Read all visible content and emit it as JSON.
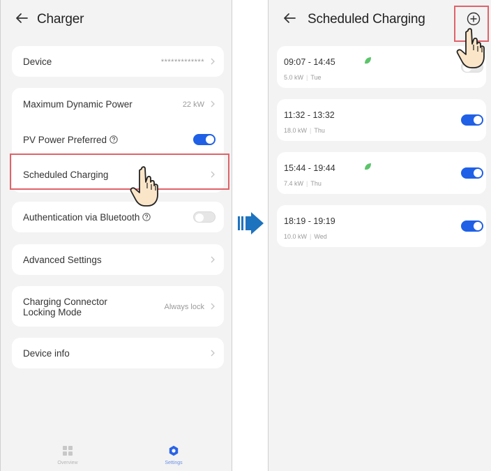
{
  "left": {
    "title": "Charger",
    "device": {
      "label": "Device",
      "value": "*************"
    },
    "max_power": {
      "label": "Maximum Dynamic Power",
      "value": "22 kW"
    },
    "pv_preferred": {
      "label": "PV Power Preferred",
      "state": "on"
    },
    "scheduled": {
      "label": "Scheduled Charging"
    },
    "bluetooth": {
      "label": "Authentication via Bluetooth",
      "state": "off"
    },
    "advanced": {
      "label": "Advanced Settings"
    },
    "locking": {
      "label_line1": "Charging Connector",
      "label_line2": "Locking Mode",
      "value": "Always lock"
    },
    "device_info": {
      "label": "Device info"
    },
    "tabs": [
      {
        "label": "Overview",
        "icon": "grid-icon",
        "active": false
      },
      {
        "label": "Settings",
        "icon": "gear-icon",
        "active": true
      }
    ]
  },
  "right": {
    "title": "Scheduled Charging",
    "schedules": [
      {
        "time": "09:07 - 14:45",
        "power": "5.0 kW",
        "day": "Tue",
        "leaf": true,
        "enabled": false
      },
      {
        "time": "11:32 - 13:32",
        "power": "18.0 kW",
        "day": "Thu",
        "leaf": false,
        "enabled": true
      },
      {
        "time": "15:44 - 19:44",
        "power": "7.4 kW",
        "day": "Thu",
        "leaf": true,
        "enabled": true
      },
      {
        "time": "18:19 - 19:19",
        "power": "10.0 kW",
        "day": "Wed",
        "leaf": false,
        "enabled": true
      }
    ]
  },
  "colors": {
    "toggle_on": "#1f60e6",
    "highlight": "#e0626a",
    "flow_arrow": "#1e73be",
    "leaf": "#5cc46a",
    "active_tab": "#2a63e6"
  }
}
